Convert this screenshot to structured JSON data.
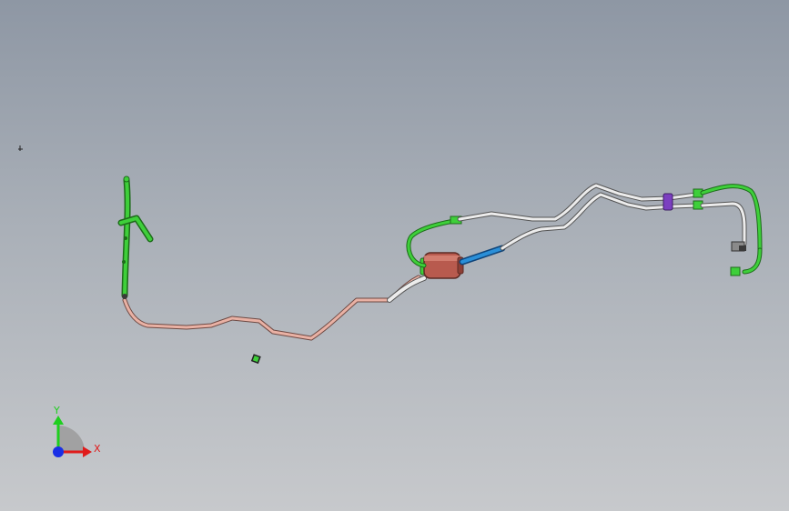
{
  "app": {
    "view": "cad-3d-graphics-area",
    "background": {
      "top": "#8e97a4",
      "bottom": "#c7c9cc"
    }
  },
  "model": {
    "description_icon": "fuel-line-assembly",
    "colors": {
      "main_pipe": "#e9b1a4",
      "white_pipe": "#e8e8e8",
      "green_fitting": "#3ecf3a",
      "filter_body": "#b85a4e",
      "blue_hose": "#2a8fd8",
      "purple_clip": "#7b3fc0",
      "dark_connector": "#3a3a3a"
    }
  },
  "triad": {
    "x_label": "X",
    "y_label": "Y",
    "x_color": "#e01b1b",
    "y_color": "#1fcf1f",
    "z_color": "#1a2fe6"
  }
}
